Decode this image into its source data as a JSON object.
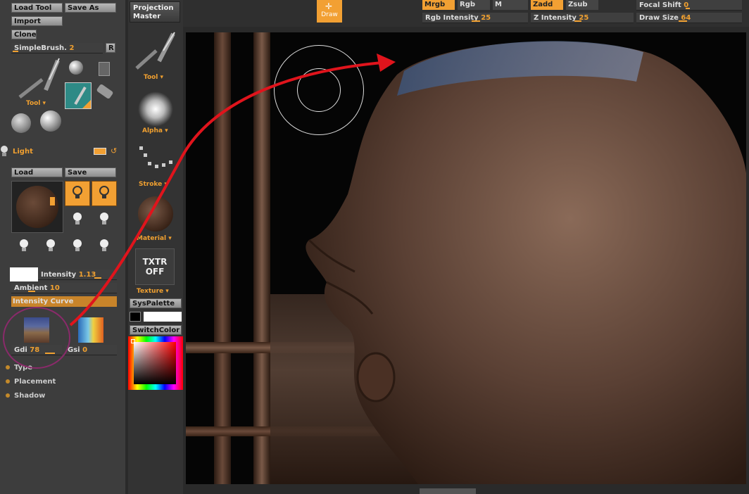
{
  "left_panel": {
    "load_tool": "Load Tool",
    "save_as": "Save As",
    "import": "Import",
    "clone": "Clone",
    "brush_slider": {
      "label": "SimpleBrush.",
      "value": "2"
    },
    "r_button": "R",
    "tool_label": "Tool",
    "light_title": "Light",
    "load": "Load",
    "save": "Save",
    "intensity": {
      "label": "Intensity",
      "value": "1.13",
      "fraction": 0.2
    },
    "ambient": {
      "label": "Ambient",
      "value": "10",
      "fraction": 0.1
    },
    "intensity_curve": "Intensity Curve",
    "gdi": {
      "label": "Gdi",
      "value": "78",
      "fraction": 0.78
    },
    "gsi": {
      "label": "Gsi",
      "value": "0",
      "fraction": 0
    },
    "sections": [
      "Type",
      "Placement",
      "Shadow"
    ]
  },
  "middle_panel": {
    "projection_master": "Projection Master",
    "tool": "Tool",
    "alpha": "Alpha",
    "stroke": "Stroke",
    "material": "Material",
    "txtr_off": "TXTR OFF",
    "texture": "Texture",
    "syspalette": "SysPalette",
    "switchcolor": "SwitchColor"
  },
  "top_bar": {
    "draw": "Draw",
    "mrgb": "Mrgb",
    "rgb": "Rgb",
    "m": "M",
    "zadd": "Zadd",
    "zsub": "Zsub",
    "focal_shift": {
      "label": "Focal Shift",
      "value": "0"
    },
    "rgb_intensity": {
      "label": "Rgb Intensity",
      "value": "25"
    },
    "z_intensity": {
      "label": "Z Intensity",
      "value": "25"
    },
    "draw_size": {
      "label": "Draw Size",
      "value": "64"
    }
  },
  "colors": {
    "accent": "#f2a033",
    "annotation_arrow": "#e0141c",
    "annotation_circle": "#8a2a6a"
  },
  "icons": [
    "light-bulb-icon",
    "draw-crosshair-icon",
    "reset-icon",
    "chevron-down-icon"
  ]
}
